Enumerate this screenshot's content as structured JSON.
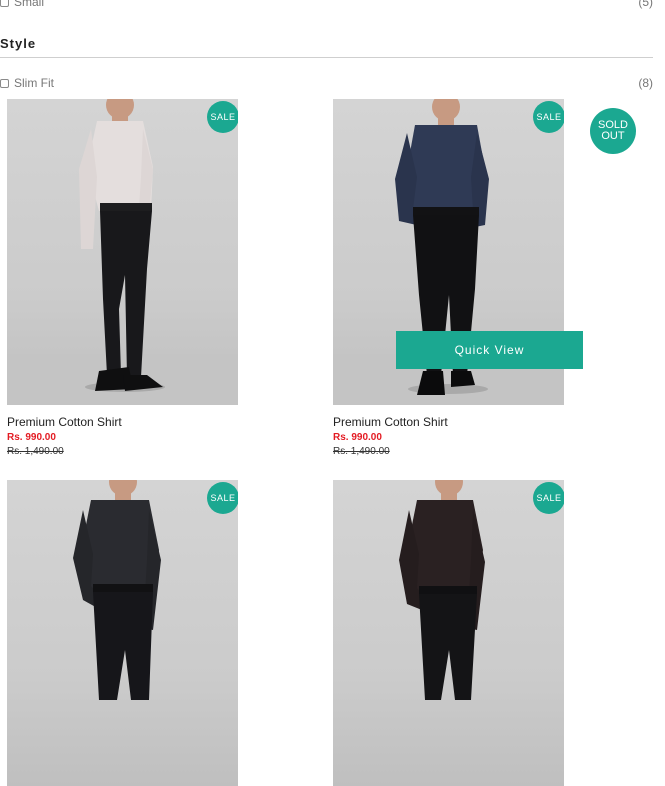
{
  "filters": {
    "size_prev": {
      "label": "Small",
      "count": "(5)"
    },
    "style": {
      "title": "Style",
      "options": [
        {
          "label": "Slim Fit",
          "count": "(8)"
        }
      ]
    }
  },
  "badges": {
    "sale": "SALE",
    "sold_out_line1": "SOLD",
    "sold_out_line2": "OUT"
  },
  "quick_view_label": "Quick View",
  "products": [
    {
      "name": "Premium Cotton Shirt",
      "price": "Rs. 990.00",
      "old_price": "Rs. 1,490.00",
      "shirt_color": "#e4dedd",
      "pants_color": "#18181b"
    },
    {
      "name": "Premium Cotton Shirt",
      "price": "Rs. 990.00",
      "old_price": "Rs. 1,490.00",
      "shirt_color": "#2f3a55",
      "pants_color": "#111113"
    },
    {
      "shirt_color": "#2a2b30",
      "pants_color": "#16161a"
    },
    {
      "shirt_color": "#2a2122",
      "pants_color": "#141416"
    }
  ],
  "colors": {
    "accent": "#1ba891",
    "price": "#e31b23"
  }
}
